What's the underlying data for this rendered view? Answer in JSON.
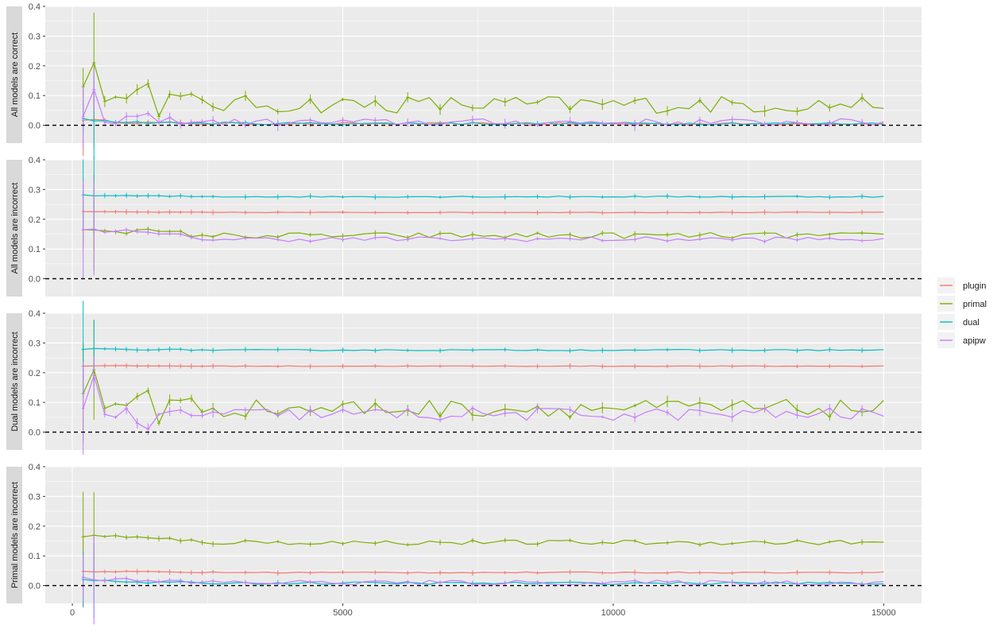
{
  "chart_data": {
    "type": "line",
    "xlim": [
      -500,
      15700
    ],
    "ylim": [
      -0.06,
      0.4
    ],
    "x_ticks": [
      0,
      5000,
      10000,
      15000
    ],
    "y_ticks": [
      0.0,
      0.1,
      0.2,
      0.3,
      0.4
    ],
    "reference_line": {
      "y": 0,
      "style": "dashed"
    },
    "grid": true,
    "legend": {
      "placement": "right",
      "items": [
        {
          "name": "plugin",
          "color": "#F8766D"
        },
        {
          "name": "primal",
          "color": "#7CAE00"
        },
        {
          "name": "dual",
          "color": "#00BFC4"
        },
        {
          "name": "apipw",
          "color": "#C77CFF"
        }
      ]
    },
    "panels": [
      {
        "label": "All models are correct",
        "series": [
          {
            "name": "plugin",
            "start": 0.02,
            "end": 0.005,
            "amp": 0.004,
            "mode": "decay"
          },
          {
            "name": "primal",
            "start": 0.12,
            "end": 0.07,
            "amp": 0.03,
            "mode": "noisy",
            "early": [
              0.13,
              0.21,
              0.08,
              0.095,
              0.09,
              0.12,
              0.14,
              0.03
            ]
          },
          {
            "name": "dual",
            "start": 0.02,
            "end": 0.006,
            "amp": 0.004,
            "mode": "decay"
          },
          {
            "name": "apipw",
            "start": 0.03,
            "end": 0.01,
            "amp": 0.012,
            "mode": "noisy",
            "early": [
              0.03,
              0.12,
              0.01,
              0.005,
              0.03,
              0.03,
              0.04,
              0.01
            ]
          }
        ]
      },
      {
        "label": "All models are incorrect",
        "series": [
          {
            "name": "plugin",
            "start": 0.225,
            "end": 0.223,
            "amp": 0.001,
            "mode": "flat"
          },
          {
            "name": "primal",
            "start": 0.17,
            "end": 0.145,
            "amp": 0.01,
            "mode": "flat"
          },
          {
            "name": "dual",
            "start": 0.28,
            "end": 0.276,
            "amp": 0.002,
            "mode": "flat"
          },
          {
            "name": "apipw",
            "start": 0.17,
            "end": 0.133,
            "amp": 0.008,
            "mode": "flat"
          }
        ]
      },
      {
        "label": "Dual models are incorrect",
        "series": [
          {
            "name": "plugin",
            "start": 0.223,
            "end": 0.222,
            "amp": 0.001,
            "mode": "flat"
          },
          {
            "name": "primal",
            "start": 0.13,
            "end": 0.08,
            "amp": 0.03,
            "mode": "noisy",
            "early": [
              0.13,
              0.21,
              0.08,
              0.095,
              0.09,
              0.12,
              0.14,
              0.03
            ]
          },
          {
            "name": "dual",
            "start": 0.28,
            "end": 0.276,
            "amp": 0.002,
            "mode": "flat"
          },
          {
            "name": "apipw",
            "start": 0.08,
            "end": 0.06,
            "amp": 0.022,
            "mode": "noisy",
            "early": [
              0.08,
              0.19,
              0.06,
              0.05,
              0.08,
              0.03,
              0.01,
              0.06
            ]
          }
        ]
      },
      {
        "label": "Primal models are incorrect",
        "series": [
          {
            "name": "plugin",
            "start": 0.048,
            "end": 0.044,
            "amp": 0.002,
            "mode": "flat"
          },
          {
            "name": "primal",
            "start": 0.17,
            "end": 0.145,
            "amp": 0.008,
            "mode": "flat"
          },
          {
            "name": "dual",
            "start": 0.02,
            "end": 0.008,
            "amp": 0.004,
            "mode": "decay"
          },
          {
            "name": "apipw",
            "start": 0.03,
            "end": 0.01,
            "amp": 0.008,
            "mode": "decay"
          }
        ]
      }
    ]
  }
}
